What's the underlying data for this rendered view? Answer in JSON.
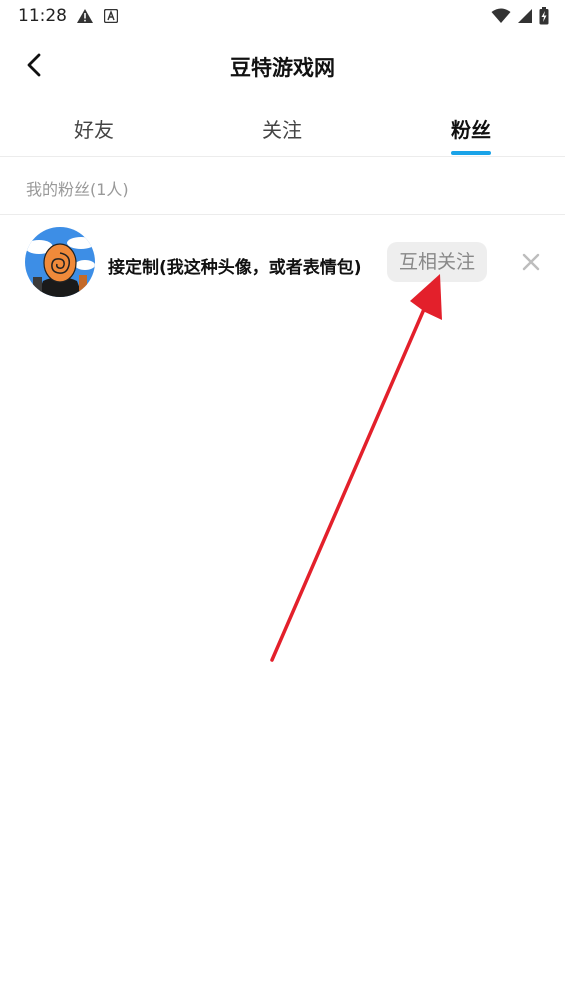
{
  "status_bar": {
    "time": "11:28",
    "icons_left": [
      "warning-icon",
      "a-icon"
    ],
    "icons_right": [
      "wifi-icon",
      "signal-icon",
      "battery-charging-icon"
    ]
  },
  "header": {
    "title": "豆特游戏网",
    "back_icon": "chevron-left-icon"
  },
  "tabs": [
    {
      "label": "好友",
      "active": false
    },
    {
      "label": "关注",
      "active": false
    },
    {
      "label": "粉丝",
      "active": true
    }
  ],
  "section": {
    "label": "我的粉丝(1人)"
  },
  "fans": [
    {
      "name": "接定制(我这种头像，或者表情包)",
      "follow_label": "互相关注",
      "remove_icon": "close-icon"
    }
  ],
  "colors": {
    "accent": "#1aa3e8",
    "annotation_arrow": "#e3202b",
    "button_bg": "#eeeeee",
    "button_text": "#888888"
  }
}
